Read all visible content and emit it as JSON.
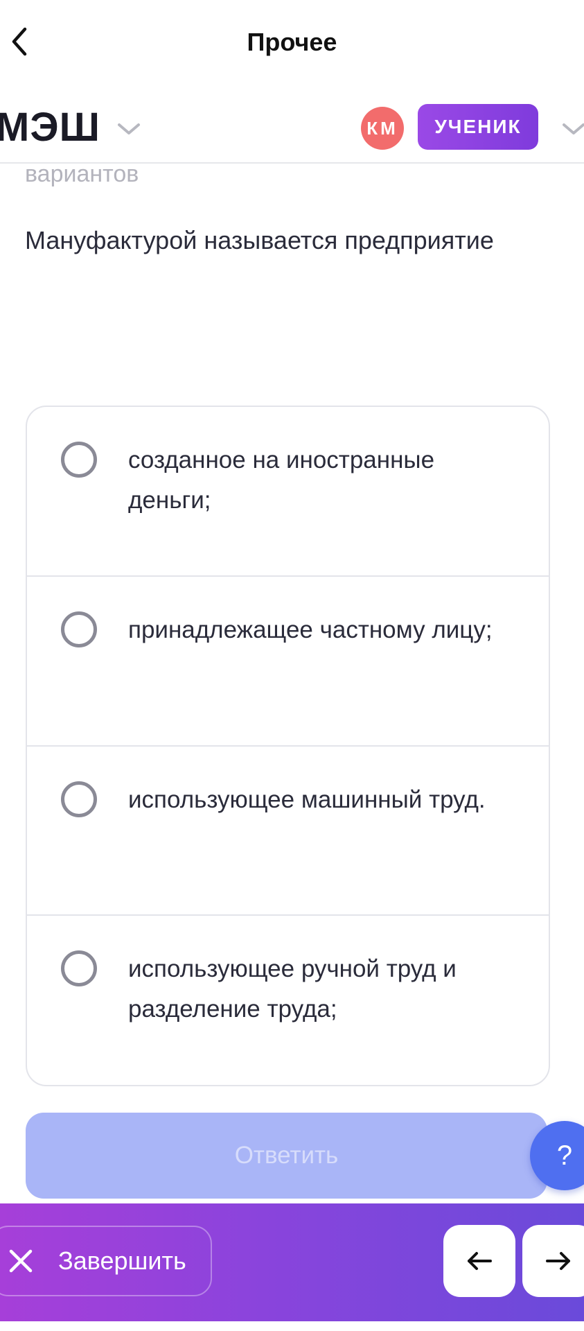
{
  "nav": {
    "title": "Прочее"
  },
  "header": {
    "logo": "МЭШ",
    "avatar_initials": "КМ",
    "role": "УЧЕНИК"
  },
  "content": {
    "hint": "вариантов",
    "question": "Мануфактурой называется предприятие",
    "options": [
      {
        "label": "созданное на иностранные деньги;",
        "selected": false
      },
      {
        "label": "принадлежащее частному лицу;",
        "selected": false
      },
      {
        "label": "использующее машинный труд.",
        "selected": false
      },
      {
        "label": "использующее ручной труд и разделение труда;",
        "selected": false
      }
    ],
    "answer_button": "Ответить",
    "help_button": "?"
  },
  "footer": {
    "finish_label": "Завершить"
  },
  "colors": {
    "accent_purple": "#8a44dc",
    "answer_button_disabled": "#a9b5f7",
    "help_button": "#4f6ff0",
    "avatar": "#f26c6c"
  },
  "icons": [
    "back-chevron-icon",
    "chevron-down-icon",
    "close-icon",
    "arrow-left-icon",
    "arrow-right-icon"
  ]
}
